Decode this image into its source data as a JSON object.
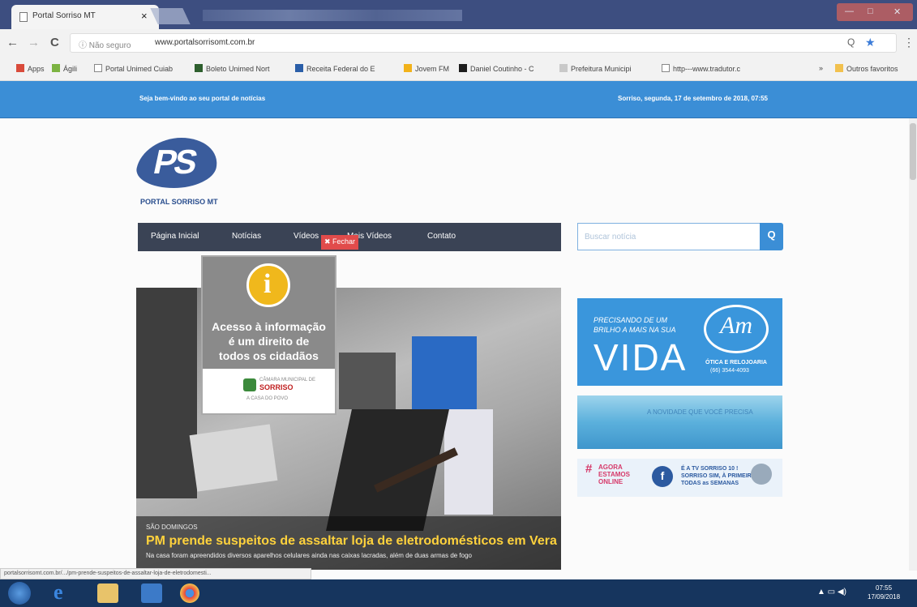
{
  "browser": {
    "tab_title": "Portal Sorriso MT",
    "tab_close": "×",
    "not_secure": "ⓘ Não seguro",
    "url": "www.portalsorrisomt.com.br",
    "zoom_icon": "Q",
    "star_icon": "★",
    "menu_icon": "⋮",
    "back": "←",
    "forward": "→",
    "reload": "C",
    "bookmarks": [
      {
        "label": "Apps",
        "color": "#d94b3b"
      },
      {
        "label": "Ágili",
        "color": "#7cb342"
      },
      {
        "label": "Portal Unimed Cuiab",
        "color": "#ffffff"
      },
      {
        "label": "Boleto Unimed Nort",
        "color": "#2e5f2e"
      },
      {
        "label": "Receita Federal do E",
        "color": "#2a5ea8"
      },
      {
        "label": "Jovem FM",
        "color": "#f2b21a"
      },
      {
        "label": "Daniel Coutinho - C",
        "color": "#1d1d1d"
      },
      {
        "label": "Prefeitura Municipi",
        "color": "#c9c9c9"
      },
      {
        "label": "http---www.tradutor.c",
        "color": "#ffffff"
      }
    ],
    "bookmarks_more": "»",
    "other_bookmarks": "Outros favoritos",
    "status_url": "portalsorrisomt.com.br/.../pm-prende-suspeitos-de-assaltar-loja-de-eletrodomesti..."
  },
  "site": {
    "welcome": "Seja bem-vindo ao seu portal de notícias",
    "date_line": "Sorriso, segunda, 17 de setembro de 2018, 07:55",
    "logo_letters": "PS",
    "logo_sub": "PORTAL SORRISO MT",
    "nav": [
      "Página Inicial",
      "Notícias",
      "Vídeos",
      "Mais Vídeos",
      "Contato"
    ],
    "close_popup": "✖ Fechar",
    "search_placeholder": "Buscar notícia",
    "search_button": "Q",
    "popup": {
      "icon": "i",
      "line1": "Acesso à informação",
      "line2": "é um direito de",
      "line3": "todos os cidadãos",
      "org_top": "CÂMARA MUNICIPAL DE",
      "org": "SORRISO",
      "org_bottom": "A CASA DO POVO"
    },
    "hero": {
      "category": "SÃO DOMINGOS",
      "headline": "PM prende suspeitos de assaltar loja de eletrodomésticos em Vera",
      "summary": "Na casa foram apreendidos diversos aparelhos celulares ainda nas caixas lacradas, além de duas armas de fogo"
    },
    "ad_otica": {
      "line1": "PRECISANDO DE UM",
      "line2": "BRILHO A MAIS NA SUA",
      "vida": "VIDA",
      "logo": "Am",
      "name": "ÓTICA E RELOJOARIA",
      "phone": "(66) 3544-4093"
    },
    "ad_blue": "A NOVIDADE QUE VOCÊ PRECISA",
    "ad_tv": {
      "hash": "#",
      "words": [
        "AGORA",
        "ESTAMOS",
        "ONLINE"
      ],
      "fb": "f",
      "text1": "É A TV SORRISO 10 !",
      "text2": "SORRISO SIM, À PRIMEIRA!",
      "text3": "TODAS as SEMANAS"
    }
  },
  "taskbar": {
    "time": "07:55",
    "date": "17/09/2018"
  }
}
